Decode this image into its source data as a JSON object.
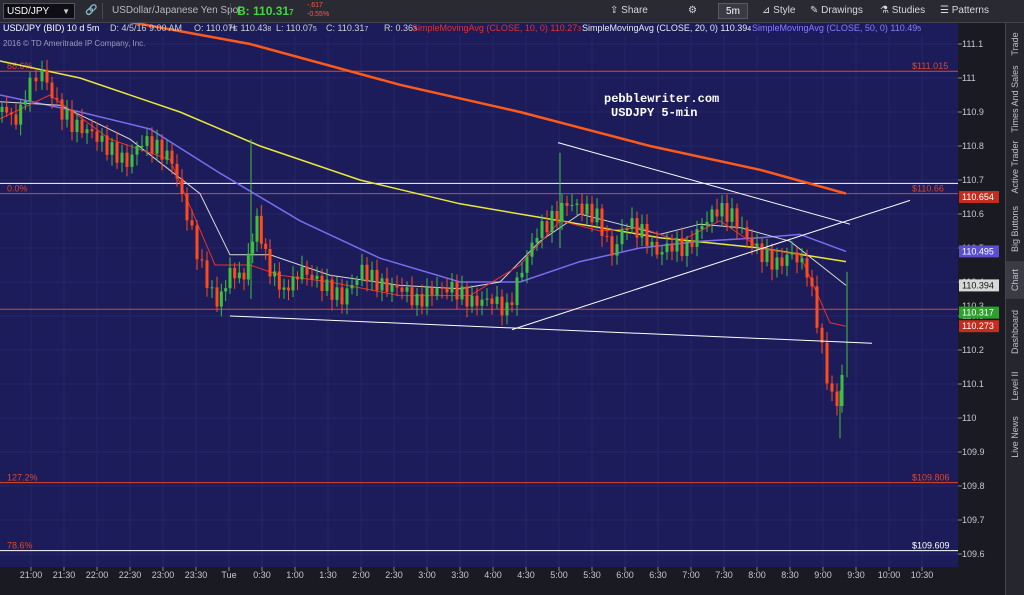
{
  "toolbar": {
    "symbol": "USD/JPY",
    "description": "USDollar/Japanese Yen Spot",
    "bid_label": "B:",
    "bid_price": "110.31",
    "bid_price_small": "7",
    "change1": "-.617",
    "change2": "-0.55%",
    "share": "Share",
    "timeframe": "5m",
    "style": "Style",
    "drawings": "Drawings",
    "studies": "Studies",
    "patterns": "Patterns"
  },
  "info_bar": {
    "symbol": "USD/JPY (BID) 10 d 5m",
    "date": "D: 4/5/16 9:00 AM",
    "open": "O: 110.07",
    "open_small": "5",
    "high": "H: 110.43",
    "high_small": "8",
    "low": "L: 110.07",
    "low_small": "5",
    "close": "C: 110.31",
    "close_small": "7",
    "range": "R: 0.36",
    "range_small": "3",
    "sma10": "SimpleMovingAvg (CLOSE, 10, 0)",
    "sma10_val": "110.27",
    "sma10_val_small": "3",
    "sma20": "SimpleMovingAvg (CLOSE, 20, 0)",
    "sma20_val": "110.39",
    "sma20_val_small": "4",
    "sma50": "SimpleMovingAvg (CLOSE, 50, 0)",
    "sma50_val": "110.49",
    "sma50_val_small": "5",
    "copyright": "2016 © TD Ameritrade IP Company, Inc."
  },
  "annotation": {
    "line1": "pebblewriter.com",
    "line2": "USDJPY 5-min"
  },
  "colors": {
    "bg": "#1c1c5a",
    "up": "#3fbf3f",
    "down": "#ff4a1c",
    "sma10": "#e8312a",
    "sma20": "#d8d8d8",
    "sma50": "#7a6cf0",
    "sma200": "#e8e83a",
    "sma100": "#ff5a1a",
    "fib": "#e0462a"
  },
  "fib_levels": [
    {
      "pct": "88.6%",
      "price": "$111.01",
      "price_small": "5",
      "value": 111.02
    },
    {
      "pct": "0.0%",
      "price": "$110.66",
      "price_small": "",
      "value": 110.66
    },
    {
      "pct": "127.2%",
      "price": "$109.80",
      "price_small": "6",
      "value": 109.81
    },
    {
      "pct": "78.6%",
      "price": "$109.60",
      "price_small": "9",
      "value": 109.61
    }
  ],
  "price_tags": [
    {
      "price": "110.65",
      "small": "4",
      "value": 110.65,
      "color": "#c42d1d"
    },
    {
      "price": "110.49",
      "small": "5",
      "value": 110.49,
      "color": "#5a4fd0"
    },
    {
      "price": "110.39",
      "small": "4",
      "value": 110.39,
      "color": "#d8d8d8"
    },
    {
      "price": "110.31",
      "small": "7",
      "value": 110.31,
      "color": "#2ea02e"
    },
    {
      "price": "110.27",
      "small": "3",
      "value": 110.27,
      "color": "#c42d1d"
    }
  ],
  "price_label_overlap": "110.3",
  "y_ticks": [
    "109.6",
    "109.7",
    "109.8",
    "109.9",
    "110",
    "110.1",
    "110.2",
    "110.3",
    "110.4",
    "110.5",
    "110.6",
    "110.7",
    "110.8",
    "110.9",
    "111",
    "111.1"
  ],
  "x_ticks": [
    "21:00",
    "21:30",
    "22:00",
    "22:30",
    "23:00",
    "23:30",
    "Tue",
    "0:30",
    "1:00",
    "1:30",
    "2:00",
    "2:30",
    "3:00",
    "3:30",
    "4:00",
    "4:30",
    "5:00",
    "5:30",
    "6:00",
    "6:30",
    "7:00",
    "7:30",
    "8:00",
    "8:30",
    "9:00",
    "9:30",
    "10:00",
    "10:30"
  ],
  "right_tabs": [
    "Trade",
    "Times And Sales",
    "Active Trader",
    "Big Buttons",
    "Chart",
    "Dashboard",
    "Level II",
    "Live News"
  ]
}
